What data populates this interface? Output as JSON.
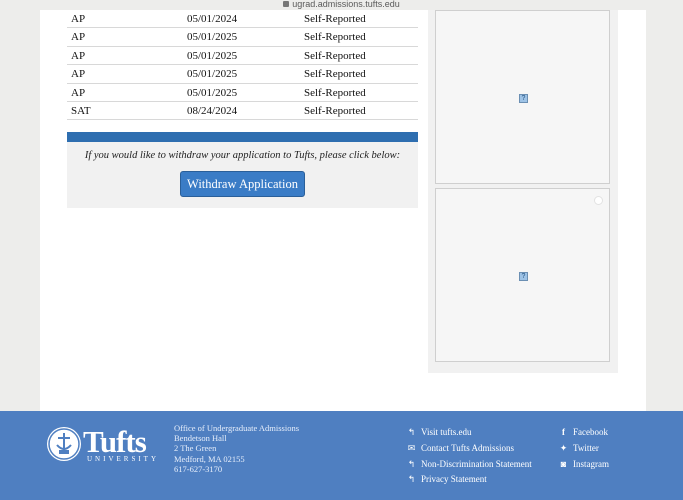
{
  "browser": {
    "url": "ugrad.admissions.tufts.edu"
  },
  "tests": {
    "rows": [
      {
        "test": "AP",
        "date": "05/01/2024",
        "status": "Self-Reported"
      },
      {
        "test": "AP",
        "date": "05/01/2025",
        "status": "Self-Reported"
      },
      {
        "test": "AP",
        "date": "05/01/2025",
        "status": "Self-Reported"
      },
      {
        "test": "AP",
        "date": "05/01/2025",
        "status": "Self-Reported"
      },
      {
        "test": "AP",
        "date": "05/01/2025",
        "status": "Self-Reported"
      },
      {
        "test": "SAT",
        "date": "08/24/2024",
        "status": "Self-Reported"
      }
    ]
  },
  "withdraw": {
    "prompt": "If you would like to withdraw your application to Tufts, please click below:",
    "button_label": "Withdraw Application"
  },
  "sidebar": {
    "broken_icon": "?"
  },
  "footer": {
    "logo": {
      "name": "Tufts",
      "sub": "UNIVERSITY"
    },
    "address": [
      "Office of Undergraduate Admissions",
      "Bendetson Hall",
      "2 The Green",
      "Medford, MA 02155",
      "617-627-3170"
    ],
    "links": [
      {
        "label": "Visit tufts.edu",
        "icon": "reply-arrow-icon"
      },
      {
        "label": "Contact Tufts Admissions",
        "icon": "envelope-icon"
      },
      {
        "label": "Non-Discrimination Statement",
        "icon": "reply-arrow-icon"
      },
      {
        "label": "Privacy Statement",
        "icon": "reply-arrow-icon"
      }
    ],
    "social": [
      {
        "label": "Facebook",
        "icon": "facebook-icon"
      },
      {
        "label": "Twitter",
        "icon": "twitter-icon"
      },
      {
        "label": "Instagram",
        "icon": "instagram-icon"
      }
    ]
  },
  "colors": {
    "accent": "#2e6eb0",
    "footer_bg": "#4f7fc1",
    "button": "#3a7cc6"
  }
}
